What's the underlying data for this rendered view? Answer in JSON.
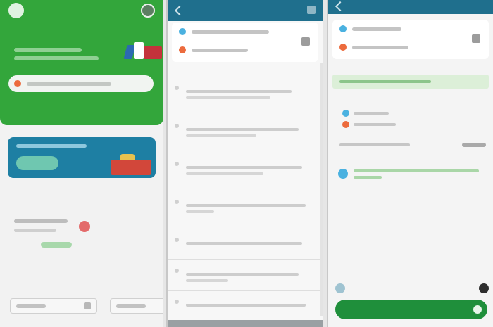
{
  "screen1": {
    "greeting": "",
    "search_placeholder": "",
    "banner_cta": "",
    "recent_title": "",
    "recent_more": "",
    "saved_title": ""
  },
  "screen2": {
    "title": "",
    "pickup": "",
    "dropoff": "",
    "options": [
      {
        "title": ""
      },
      {
        "title": ""
      },
      {
        "title": ""
      },
      {
        "title": ""
      },
      {
        "title": ""
      },
      {
        "title": ""
      },
      {
        "title": ""
      }
    ]
  },
  "screen3": {
    "title": "",
    "route_title": "",
    "payment_label": "",
    "book_label": "",
    "book_price": ""
  },
  "colors": {
    "brand_green": "#33a63b",
    "header_teal": "#1f6f8d",
    "banner_blue": "#1e7fa3",
    "pickup_dot": "#4ab1e0",
    "dropoff_dot": "#ec6b3d",
    "cta_green": "#1f8f3b"
  },
  "icons": [
    "menu-icon",
    "profile-icon",
    "location-pin-icon",
    "back-icon",
    "close-icon",
    "swap-icon",
    "info-icon",
    "wallet-icon",
    "more-icon",
    "arrow-right-icon"
  ]
}
